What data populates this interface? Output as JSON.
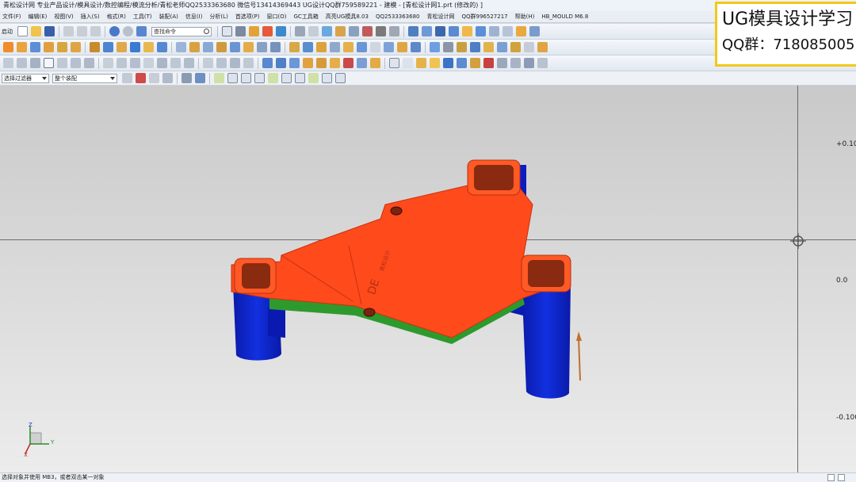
{
  "titlebar": {
    "text": "青松设计网 专业产品设计/模具设计/数控编程/模流分析/青松老师QQ2533363680 微信号13414369443 UG设计QQ群759589221 - 建模 - [青松设计网1.prt  (修改的)  ]"
  },
  "menu": [
    {
      "label": "文件(F)"
    },
    {
      "label": "编辑(E)"
    },
    {
      "label": "视图(V)"
    },
    {
      "label": "插入(S)"
    },
    {
      "label": "格式(R)"
    },
    {
      "label": "工具(T)"
    },
    {
      "label": "装配(A)"
    },
    {
      "label": "信息(I)"
    },
    {
      "label": "分析(L)"
    },
    {
      "label": "首选项(P)"
    },
    {
      "label": "窗口(O)"
    },
    {
      "label": "GC工具箱"
    },
    {
      "label": "高亮UG模具8.03"
    },
    {
      "label": "QQ2533363680"
    },
    {
      "label": "青松设计网"
    },
    {
      "label": "QQ群996527217"
    },
    {
      "label": "帮助(H)"
    },
    {
      "label": "HB_MOULD M6.8"
    }
  ],
  "toolbar": {
    "start_label": "启动",
    "command_search_placeholder": "查找命令",
    "selection_filter": "选择过滤器",
    "assembly_scope": "整个装配"
  },
  "watermark": {
    "line1": "UG模具设计学习",
    "line2": "QQ群：718085005"
  },
  "viewport": {
    "scale_top": "+0.10",
    "scale_mid": "0.0",
    "scale_bottom": "-0.100",
    "part_text_large": "DE",
    "part_text_small": "青松设计",
    "colors": {
      "top_face": "#ff4a1c",
      "side_green": "#2e9a2e",
      "legs": "#0a1fc8",
      "background_top": "#c9c9c9",
      "background_bottom": "#ececec"
    }
  },
  "triad": {
    "x": "X",
    "y": "Y",
    "z": "Z"
  },
  "status": {
    "text": "选择对象并使用 MB3，或者双击某一对象"
  }
}
